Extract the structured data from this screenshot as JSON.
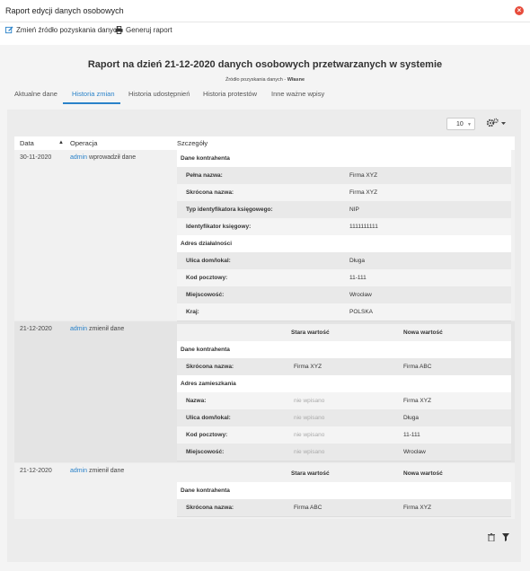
{
  "window": {
    "title": "Raport edycji danych osobowych"
  },
  "toolbar": {
    "change_source": "Zmień źródło pozyskania danych",
    "generate_report": "Generuj raport"
  },
  "report": {
    "title": "Raport na dzień 21-12-2020 danych osobowych przetwarzanych w systemie",
    "source_label": "Źródło pozyskania danych - ",
    "source_value": "Własne"
  },
  "tabs": [
    "Aktualne dane",
    "Historia zmian",
    "Historia udostępnień",
    "Historia protestów",
    "Inne ważne wpisy"
  ],
  "active_tab": "Historia zmian",
  "pager": {
    "page_size": "10"
  },
  "grid": {
    "columns": {
      "date": "Data",
      "operation": "Operacja",
      "details": "Szczegóły"
    },
    "rows": [
      {
        "date": "30-11-2020",
        "user": "admin",
        "action": "wprowadził dane",
        "sections": [
          {
            "title": "Dane kontrahenta",
            "fields": [
              {
                "label": "Pełna nazwa:",
                "value": "Firma XYZ"
              },
              {
                "label": "Skrócona nazwa:",
                "value": "Firma XYZ"
              },
              {
                "label": "Typ identyfikatora księgowego:",
                "value": "NIP"
              },
              {
                "label": "Identyfikator księgowy:",
                "value": "1111111111"
              }
            ]
          },
          {
            "title": "Adres działalności",
            "fields": [
              {
                "label": "Ulica dom/lokal:",
                "value": "Długa"
              },
              {
                "label": "Kod pocztowy:",
                "value": "11-111"
              },
              {
                "label": "Miejscowość:",
                "value": "Wrocław"
              },
              {
                "label": "Kraj:",
                "value": "POLSKA"
              }
            ]
          }
        ]
      },
      {
        "date": "21-12-2020",
        "user": "admin",
        "action": "zmienił dane",
        "old_header": "Stara wartość",
        "new_header": "Nowa wartość",
        "sections": [
          {
            "title": "Dane kontrahenta",
            "fields": [
              {
                "label": "Skrócona nazwa:",
                "old": "Firma XYZ",
                "new": "Firma ABC"
              }
            ]
          },
          {
            "title": "Adres zamieszkania",
            "fields": [
              {
                "label": "Nazwa:",
                "old": "nie wpisano",
                "new": "Firma XYZ"
              },
              {
                "label": "Ulica dom/lokal:",
                "old": "nie wpisano",
                "new": "Długa"
              },
              {
                "label": "Kod pocztowy:",
                "old": "nie wpisano",
                "new": "11-111"
              },
              {
                "label": "Miejscowość:",
                "old": "nie wpisano",
                "new": "Wrocław"
              }
            ]
          }
        ]
      },
      {
        "date": "21-12-2020",
        "user": "admin",
        "action": "zmienił dane",
        "old_header": "Stara wartość",
        "new_header": "Nowa wartość",
        "sections": [
          {
            "title": "Dane kontrahenta",
            "fields": [
              {
                "label": "Skrócona nazwa:",
                "old": "Firma ABC",
                "new": "Firma XYZ"
              }
            ]
          }
        ]
      }
    ]
  }
}
